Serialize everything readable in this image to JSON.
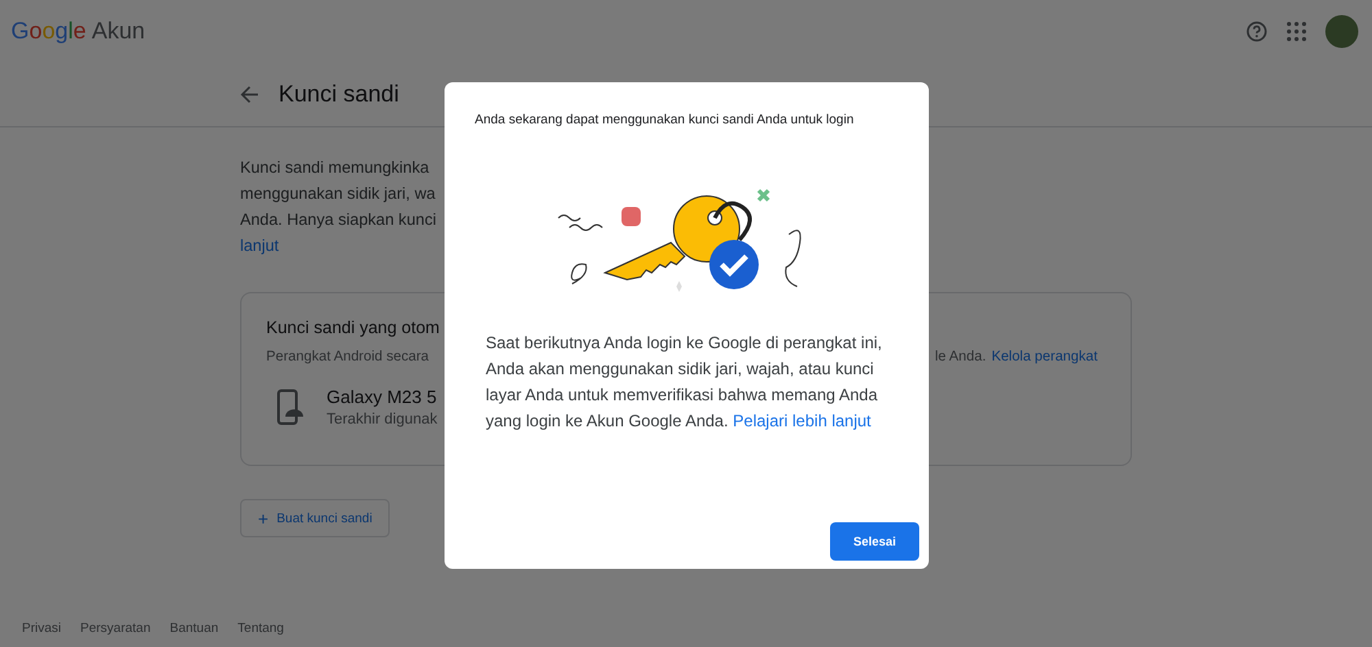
{
  "header": {
    "logo": "Google",
    "product": "Akun"
  },
  "page": {
    "title": "Kunci sandi",
    "intro_lines": [
      "Kunci sandi memungkinka",
      "menggunakan sidik jari, wa",
      "Anda. Hanya siapkan kunci"
    ],
    "intro_link": "lanjut"
  },
  "card": {
    "title": "Kunci sandi yang otom",
    "description": "Perangkat Android secara",
    "description_end": "le Anda.",
    "link": "Kelola perangkat",
    "device": {
      "name": "Galaxy M23 5",
      "detail": "Terakhir digunak"
    }
  },
  "create_button": {
    "icon": "+",
    "label": "Buat kunci sandi"
  },
  "footer": {
    "links": [
      "Privasi",
      "Persyaratan",
      "Bantuan",
      "Tentang"
    ]
  },
  "dialog": {
    "title": "Anda sekarang dapat menggunakan kunci sandi Anda untuk login",
    "body": "Saat berikutnya Anda login ke Google di perangkat ini, Anda akan menggunakan sidik jari, wajah, atau kunci layar Anda untuk memverifikasi bahwa memang Anda yang login ke Akun Google Anda.",
    "link": "Pelajari lebih lanjut",
    "button": "Selesai"
  }
}
